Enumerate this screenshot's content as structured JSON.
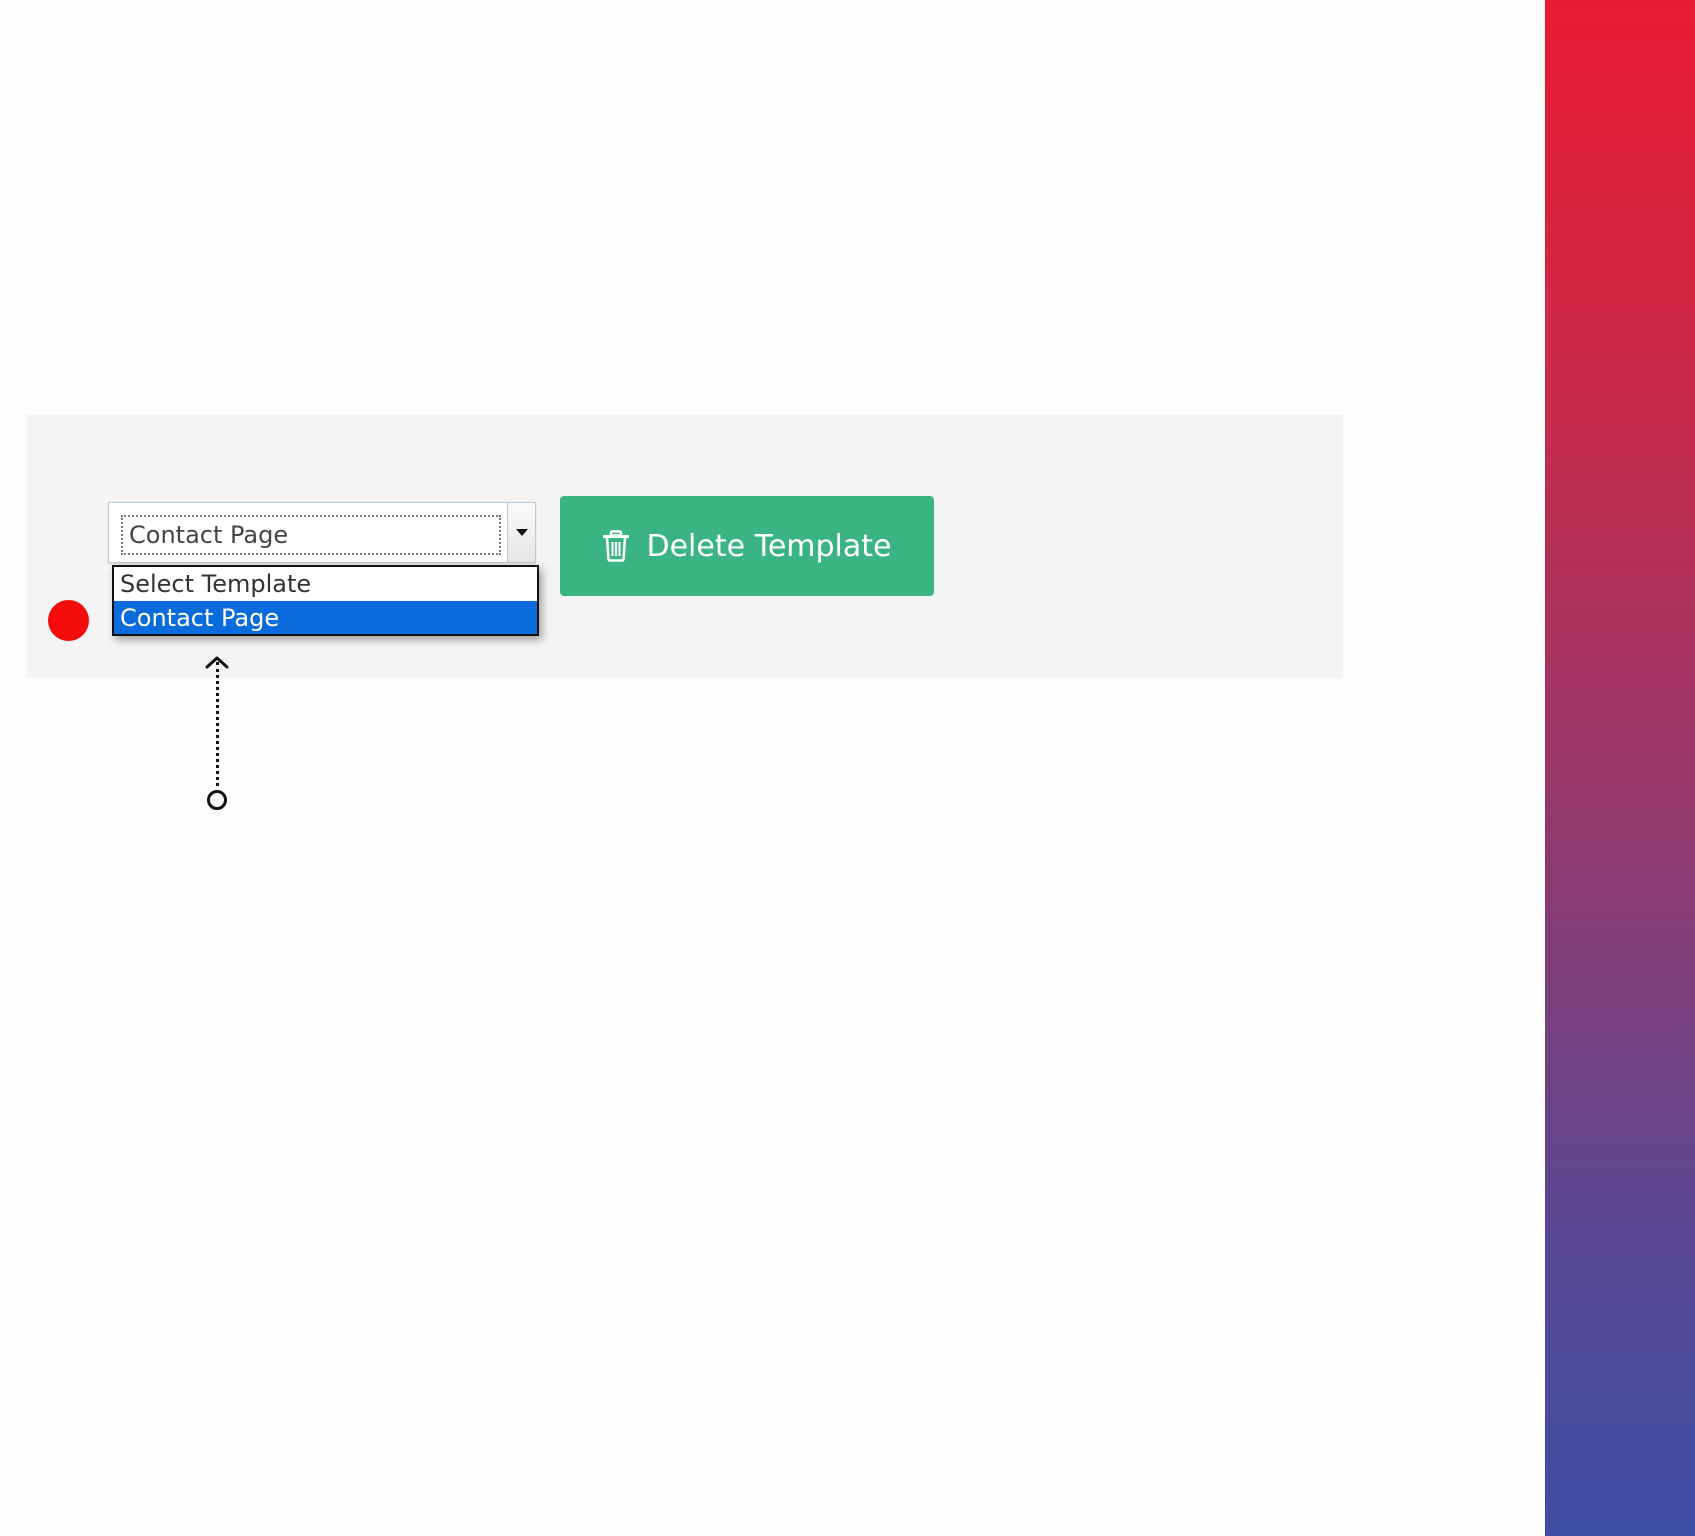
{
  "template_select": {
    "selected_value": "Contact Page",
    "options": [
      {
        "label": "Select Template",
        "selected": false
      },
      {
        "label": "Contact Page",
        "selected": true
      }
    ]
  },
  "delete_button": {
    "label": "Delete Template",
    "icon": "trash-icon",
    "color": "#3ab483"
  },
  "annotations": {
    "marker_color": "#f40c0c",
    "pointer": "dotted-arrow-up"
  },
  "colors": {
    "highlight": "#0a6bdc",
    "panel_background": "#f4f4f4",
    "side_gradient_top": "#e91b33",
    "side_gradient_bottom": "#3f4ea4"
  }
}
